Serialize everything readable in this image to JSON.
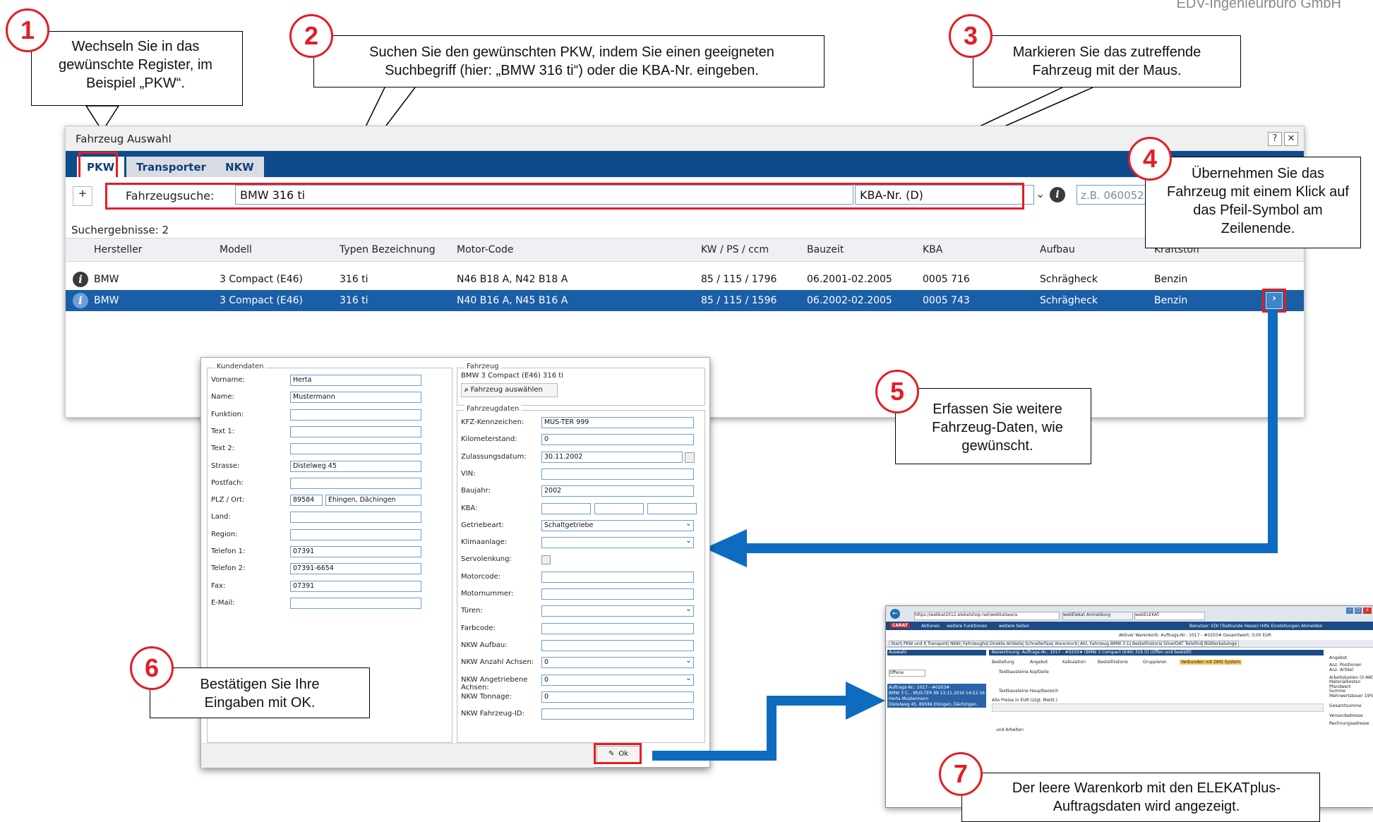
{
  "header": {
    "company": "EDV-Ingenieurbüro GmbH"
  },
  "callouts": [
    {
      "num": "1",
      "text": "Wechseln Sie in das gewünschte Register, im Beispiel „PKW“."
    },
    {
      "num": "2",
      "text": "Suchen Sie den gewünschten PKW, indem Sie einen geeigneten Suchbegriff (hier: „BMW 316 ti“) oder die KBA-Nr. eingeben."
    },
    {
      "num": "3",
      "text": "Markieren Sie das zutreffende Fahrzeug mit der Maus."
    },
    {
      "num": "4",
      "text": "Übernehmen Sie das Fahrzeug mit einem Klick auf das Pfeil-Symbol am Zeilenende."
    },
    {
      "num": "5",
      "text": "Erfassen Sie weitere Fahrzeug-Daten, wie gewünscht."
    },
    {
      "num": "6",
      "text": "Bestätigen Sie Ihre Eingaben mit OK."
    },
    {
      "num": "7",
      "text": "Der leere Warenkorb mit den ELEKATplus-Auftragsdaten wird angezeigt."
    }
  ],
  "window": {
    "title": "Fahrzeug Auswahl",
    "help": "?",
    "close": "✕",
    "tabs": [
      "PKW",
      "Transporter",
      "NKW"
    ],
    "plus": "+",
    "search_label": "Fahrzeugsuche:",
    "search_value": "BMW 316 ti",
    "kba_select": "KBA-Nr. (D)",
    "kba_placeholder": "z.B. 060052",
    "results_label": "Suchergebnisse: 2",
    "columns": [
      "Hersteller",
      "Modell",
      "Typen Bezeichnung",
      "Motor-Code",
      "KW / PS / ccm",
      "Bauzeit",
      "KBA",
      "Aufbau",
      "Kraftstoff"
    ],
    "rows": [
      [
        "BMW",
        "3 Compact (E46)",
        "316 ti",
        "N46 B18 A, N42 B18 A",
        "85 / 115 / 1796",
        "06.2001-02.2005",
        "0005 716",
        "Schrägheck",
        "Benzin"
      ],
      [
        "BMW",
        "3 Compact (E46)",
        "316 ti",
        "N40 B16 A, N45 B16 A",
        "85 / 115 / 1596",
        "06.2002-02.2005",
        "0005 743",
        "Schrägheck",
        "Benzin"
      ]
    ]
  },
  "dialog": {
    "kunden_legend": "Kundendaten",
    "kunden": [
      {
        "label": "Vorname:",
        "value": "Herta"
      },
      {
        "label": "Name:",
        "value": "Mustermann"
      },
      {
        "label": "Funktion:",
        "value": ""
      },
      {
        "label": "Text 1:",
        "value": ""
      },
      {
        "label": "Text 2:",
        "value": ""
      },
      {
        "label": "Strasse:",
        "value": "Distelweg 45"
      },
      {
        "label": "Postfach:",
        "value": ""
      },
      {
        "label": "PLZ / Ort:",
        "value": "89584"
      },
      {
        "label": "Land:",
        "value": ""
      },
      {
        "label": "Region:",
        "value": ""
      },
      {
        "label": "Telefon 1:",
        "value": "07391"
      },
      {
        "label": "Telefon 2:",
        "value": "07391-6654"
      },
      {
        "label": "Fax:",
        "value": "07391"
      },
      {
        "label": "E-Mail:",
        "value": ""
      }
    ],
    "ort": "Ehingen, Dächingen",
    "fahrzeug_legend": "Fahrzeug",
    "fahrzeug_name": "BMW 3 Compact (E46) 316 ti",
    "fahrzeug_button": "Fahrzeug auswählen",
    "fahrzeugdaten_legend": "Fahrzeugdaten",
    "fahrzeugdaten": [
      {
        "label": "KFZ-Kennzeichen:",
        "value": "MUS-TER 999"
      },
      {
        "label": "Kilometerstand:",
        "value": "0"
      },
      {
        "label": "Zulassungsdatum:",
        "value": "30.11.2002"
      },
      {
        "label": "VIN:",
        "value": ""
      },
      {
        "label": "Baujahr:",
        "value": "2002"
      },
      {
        "label": "KBA:",
        "value": ""
      },
      {
        "label": "Getriebeart:",
        "value": "Schaltgetriebe"
      },
      {
        "label": "Klimaanlage:",
        "value": ""
      },
      {
        "label": "Servolenkung:",
        "value": ""
      },
      {
        "label": "Motorcode:",
        "value": ""
      },
      {
        "label": "Motornummer:",
        "value": ""
      },
      {
        "label": "Türen:",
        "value": ""
      },
      {
        "label": "Farbcode:",
        "value": ""
      },
      {
        "label": "NKW Aufbau:",
        "value": ""
      },
      {
        "label": "NKW Anzahl Achsen:",
        "value": "0"
      },
      {
        "label": "NKW Angetriebene Achsen:",
        "value": "0"
      },
      {
        "label": "NKW Tonnage:",
        "value": "0"
      },
      {
        "label": "NKW Fahrzeug-ID:",
        "value": ""
      }
    ],
    "ok": "Ok"
  },
  "shot": {
    "url": "https://webkat2012.elekatshop.net/webkatsee/a",
    "tab1": "webElekat Anmeldung",
    "tab2": "webELEKAT",
    "brand": "CARAT",
    "menu": [
      "Aktionen",
      "weitere Funktionen",
      "weitere Seiten"
    ],
    "user": "Benutzer: EDI (Testkunde Hesse)  Hilfe  Einstellungen  Abmelden",
    "cart": "Aktiver Warenkorb: Auftrags-Nr.: 1017 - #0203#  Gesamtwert: 0,00 EUR",
    "tabs": [
      "Start",
      "PKW und Motorrad",
      "Transporter",
      "NKW",
      "Fahrzeughistorie",
      "Direkte Artikelsuche",
      "Schnellerfassung",
      "Warenkorb",
      "Akt. Fahrzeug BMW 3 Co...",
      "Bestellhistorie",
      "SilverDAT Teilefindung",
      "Blätterkataloge"
    ],
    "panel_left": "Auswahl",
    "panel_title": "Bezeichnung: Auftrags-Nr.: 1017 - #0203# (BMW 3 Compact (E46) 316 ti) (Offen und bestellt)",
    "toolbar": [
      "Bestellung",
      "Angebot",
      "Kalkulation",
      "Bestellhistorie",
      "Gruppieren",
      "Verbunden mit DMS System"
    ],
    "filter": "Offene",
    "order_lines": [
      "Auftrags-Nr.: 1017 - #0203#",
      "BMW 3 C... MUS-TER 99 13.11.2016 14:52:16",
      "Herta Mustermann",
      "Distelweg 45, 89584 Ehingen, Dächingen"
    ],
    "kopf": "Textbausteine Kopfzeile",
    "haupt": "Textbausteine Hauptbereich",
    "preise": "Alle Preise in EUR (zzgl. MwSt.)",
    "arbeiten": "und Arbeiten",
    "right_labels": [
      "Angebot",
      "Anz. Positionen",
      "Anz. Artikel",
      "Arbeitskosten (0 AW)",
      "Materialkosten",
      "Pfandwert",
      "Summe",
      "Mehrwertsteuer 19%",
      "Gesamtsumme",
      "Versandadresse",
      "Rechnungsadresse"
    ]
  },
  "colors": {
    "accent": "#e31e24",
    "window_blue": "#0d4b8c",
    "selection": "#1b5ea8",
    "flow_arrow": "#0d6cc0"
  }
}
